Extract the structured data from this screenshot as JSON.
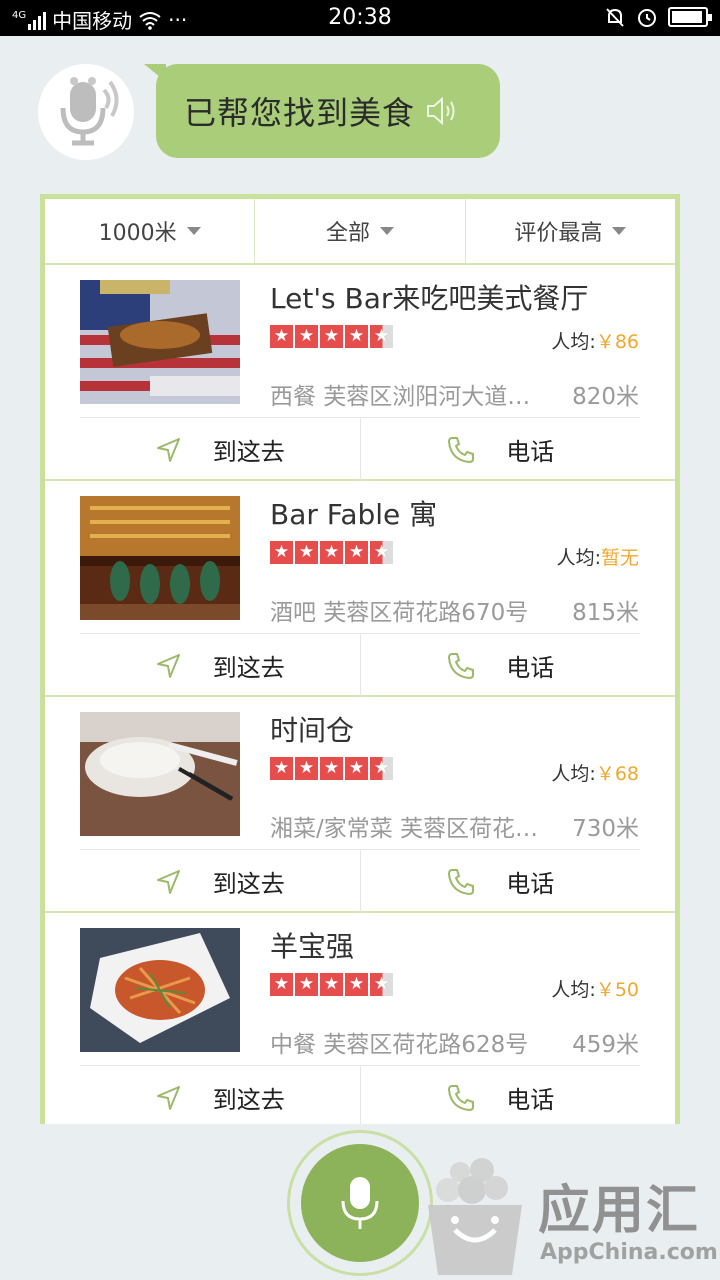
{
  "status_bar": {
    "network": "4G",
    "carrier": "中国移动",
    "more": "···",
    "time": "20:38",
    "battery_level": 0.85
  },
  "assistant": {
    "message": "已帮您找到美食"
  },
  "filters": [
    {
      "label": "1000米"
    },
    {
      "label": "全部"
    },
    {
      "label": "评价最高"
    }
  ],
  "restaurants": [
    {
      "name": "Let's Bar来吃吧美式餐厅",
      "rating": 4.5,
      "avg_label": "人均:",
      "avg_value": "￥86",
      "meta": "西餐 芙蓉区浏阳河大道…",
      "distance": "820米",
      "go_label": "到这去",
      "call_label": "电话"
    },
    {
      "name": "Bar Fable 寓",
      "rating": 4.5,
      "avg_label": "人均:",
      "avg_value": "暂无",
      "meta": "酒吧 芙蓉区荷花路670号",
      "distance": "815米",
      "go_label": "到这去",
      "call_label": "电话"
    },
    {
      "name": "时间仓",
      "rating": 4.5,
      "avg_label": "人均:",
      "avg_value": "￥68",
      "meta": "湘菜/家常菜 芙蓉区荷花…",
      "distance": "730米",
      "go_label": "到这去",
      "call_label": "电话"
    },
    {
      "name": "羊宝强",
      "rating": 4.5,
      "avg_label": "人均:",
      "avg_value": "￥50",
      "meta": "中餐 芙蓉区荷花路628号",
      "distance": "459米",
      "go_label": "到这去",
      "call_label": "电话"
    }
  ],
  "watermark": {
    "title": "应用汇",
    "subtitle": "AppChina.com"
  },
  "icons": {
    "speaker": "speaker-icon",
    "navigate": "navigate-arrow-icon",
    "phone": "phone-icon",
    "mic": "microphone-icon"
  },
  "colors": {
    "accent_green": "#a9cd78",
    "card_border": "#c9e19a",
    "star_red": "#e64e4e",
    "price_orange": "#f0a830"
  }
}
